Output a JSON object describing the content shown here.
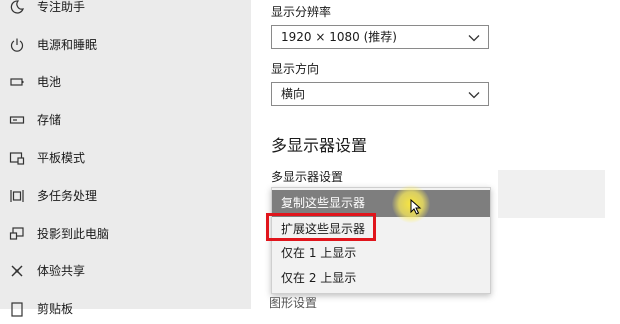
{
  "sidebar": {
    "items": [
      {
        "label": "专注助手",
        "icon": "moon-icon"
      },
      {
        "label": "电源和睡眠",
        "icon": "power-icon"
      },
      {
        "label": "电池",
        "icon": "battery-icon"
      },
      {
        "label": "存储",
        "icon": "storage-icon"
      },
      {
        "label": "平板模式",
        "icon": "tablet-mode-icon"
      },
      {
        "label": "多任务处理",
        "icon": "multitasking-icon"
      },
      {
        "label": "投影到此电脑",
        "icon": "project-icon"
      },
      {
        "label": "体验共享",
        "icon": "shared-experiences-icon"
      },
      {
        "label": "剪贴板",
        "icon": "clipboard-icon"
      }
    ]
  },
  "display": {
    "resolution_label": "显示分辨率",
    "resolution_value": "1920 × 1080 (推荐)",
    "orientation_label": "显示方向",
    "orientation_value": "横向",
    "multi_display_heading": "多显示器设置",
    "multi_display_label": "多显示器设置",
    "multi_display_options": [
      "复制这些显示器",
      "扩展这些显示器",
      "仅在 1 上显示",
      "仅在 2 上显示"
    ],
    "hovered_option_index": 0,
    "highlighted_option_index": 1,
    "bottom_partial_text": "图形设置"
  },
  "colors": {
    "sidebar_bg": "#ebebeb",
    "hover_bg": "#7e7e7e",
    "annotation_red": "#e0151c",
    "cursor_halo": "#ffeb3c"
  }
}
